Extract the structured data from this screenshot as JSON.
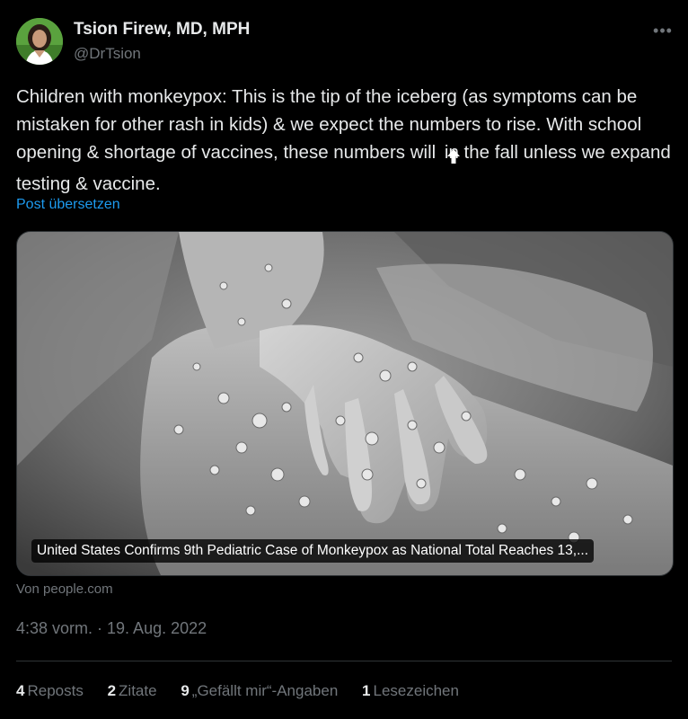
{
  "author": {
    "name": "Tsion Firew, MD, MPH",
    "handle": "@DrTsion",
    "avatar_icon": "profile-photo"
  },
  "more_icon": "more-horizontal-icon",
  "tweet": {
    "text_before_emoji": "Children with monkeypox: This is the tip of the iceberg (as symptoms can be mistaken for other rash in kids) & we expect the numbers to rise. With school opening & shortage of vaccines, these numbers will ",
    "emoji": "up-arrow-emoji",
    "text_after_emoji": "in the fall unless we expand testing & vaccine.",
    "translate_link": "Post übersetzen"
  },
  "card": {
    "caption": "United States Confirms 9th Pediatric Case of Monkeypox as National Total Reaches 13,...",
    "source": "Von people.com",
    "image_description": "photo"
  },
  "timestamp": "4:38 vorm. · 19. Aug. 2022",
  "stats": [
    {
      "count": "4",
      "label": "Reposts"
    },
    {
      "count": "2",
      "label": "Zitate"
    },
    {
      "count": "9",
      "label": "„Gefällt mir“-Angaben"
    },
    {
      "count": "1",
      "label": "Lesezeichen"
    }
  ],
  "colors": {
    "background": "#000000",
    "text": "#e7e9ea",
    "secondary": "#71767b",
    "link": "#1d9bf0",
    "border": "#2f3336"
  }
}
